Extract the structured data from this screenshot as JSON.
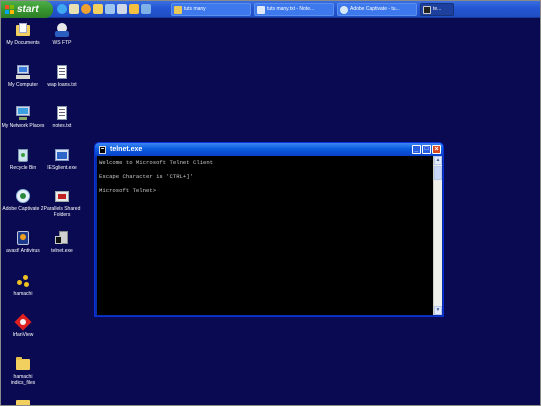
{
  "taskbar": {
    "start_label": "start",
    "quick_launch_icons": [
      "browser-icon",
      "mail-icon",
      "media-icon",
      "folder-icon",
      "app-icon",
      "app-icon",
      "app-icon",
      "app-icon"
    ],
    "tasks": [
      {
        "label": "tuts many",
        "icon": "folder-icon",
        "color": "#e9c85a"
      },
      {
        "label": "tuts many.txt - Note...",
        "icon": "notepad-icon",
        "color": "#dfe8f6"
      },
      {
        "label": "Adobe Captivate - tu...",
        "icon": "captivate-icon",
        "color": "#d7e9f9"
      },
      {
        "label": "te...",
        "icon": "telnet-icon",
        "color": "#222222"
      }
    ]
  },
  "desktop": {
    "icons": [
      {
        "label": "My Documents",
        "name": "my-documents-icon"
      },
      {
        "label": "WS FTP",
        "name": "ws-ftp-icon"
      },
      {
        "label": "My Computer",
        "name": "my-computer-icon"
      },
      {
        "label": "wap loans.txt",
        "name": "text-file-icon"
      },
      {
        "label": "My Network Places",
        "name": "network-places-icon"
      },
      {
        "label": "notes.txt",
        "name": "text-file-icon"
      },
      {
        "label": "Recycle Bin",
        "name": "recycle-bin-icon"
      },
      {
        "label": "IESglient.exe",
        "name": "exe-icon"
      },
      {
        "label": "Adobe Captivate 2",
        "name": "captivate-icon"
      },
      {
        "label": "Parallels Shared Folders",
        "name": "parallels-folders-icon"
      },
      {
        "label": "avast! Antivirus",
        "name": "avast-icon"
      },
      {
        "label": "telnet.exe",
        "name": "telnet-exe-icon"
      },
      {
        "label": "hamachi",
        "name": "hamachi-icon"
      },
      {
        "label": "IrfanView",
        "name": "irfanview-icon"
      },
      {
        "label": "hamachi indics_files",
        "name": "folder-icon"
      }
    ]
  },
  "window": {
    "title": "telnet.exe",
    "buttons": {
      "minimize": "_",
      "maximize": "□",
      "close": "×"
    },
    "console_lines": [
      "Welcome to Microsoft Telnet Client",
      "Escape Character is 'CTRL+]'",
      "Microsoft Telnet>"
    ],
    "scroll_up": "▲",
    "scroll_down": "▼"
  },
  "colors": {
    "desktop": "#0a0a52",
    "taskbar": "#245edb",
    "start_button": "#37962f",
    "title_bar": "#0a5ce0",
    "console_bg": "#000000",
    "console_text": "#c8c8c8"
  }
}
